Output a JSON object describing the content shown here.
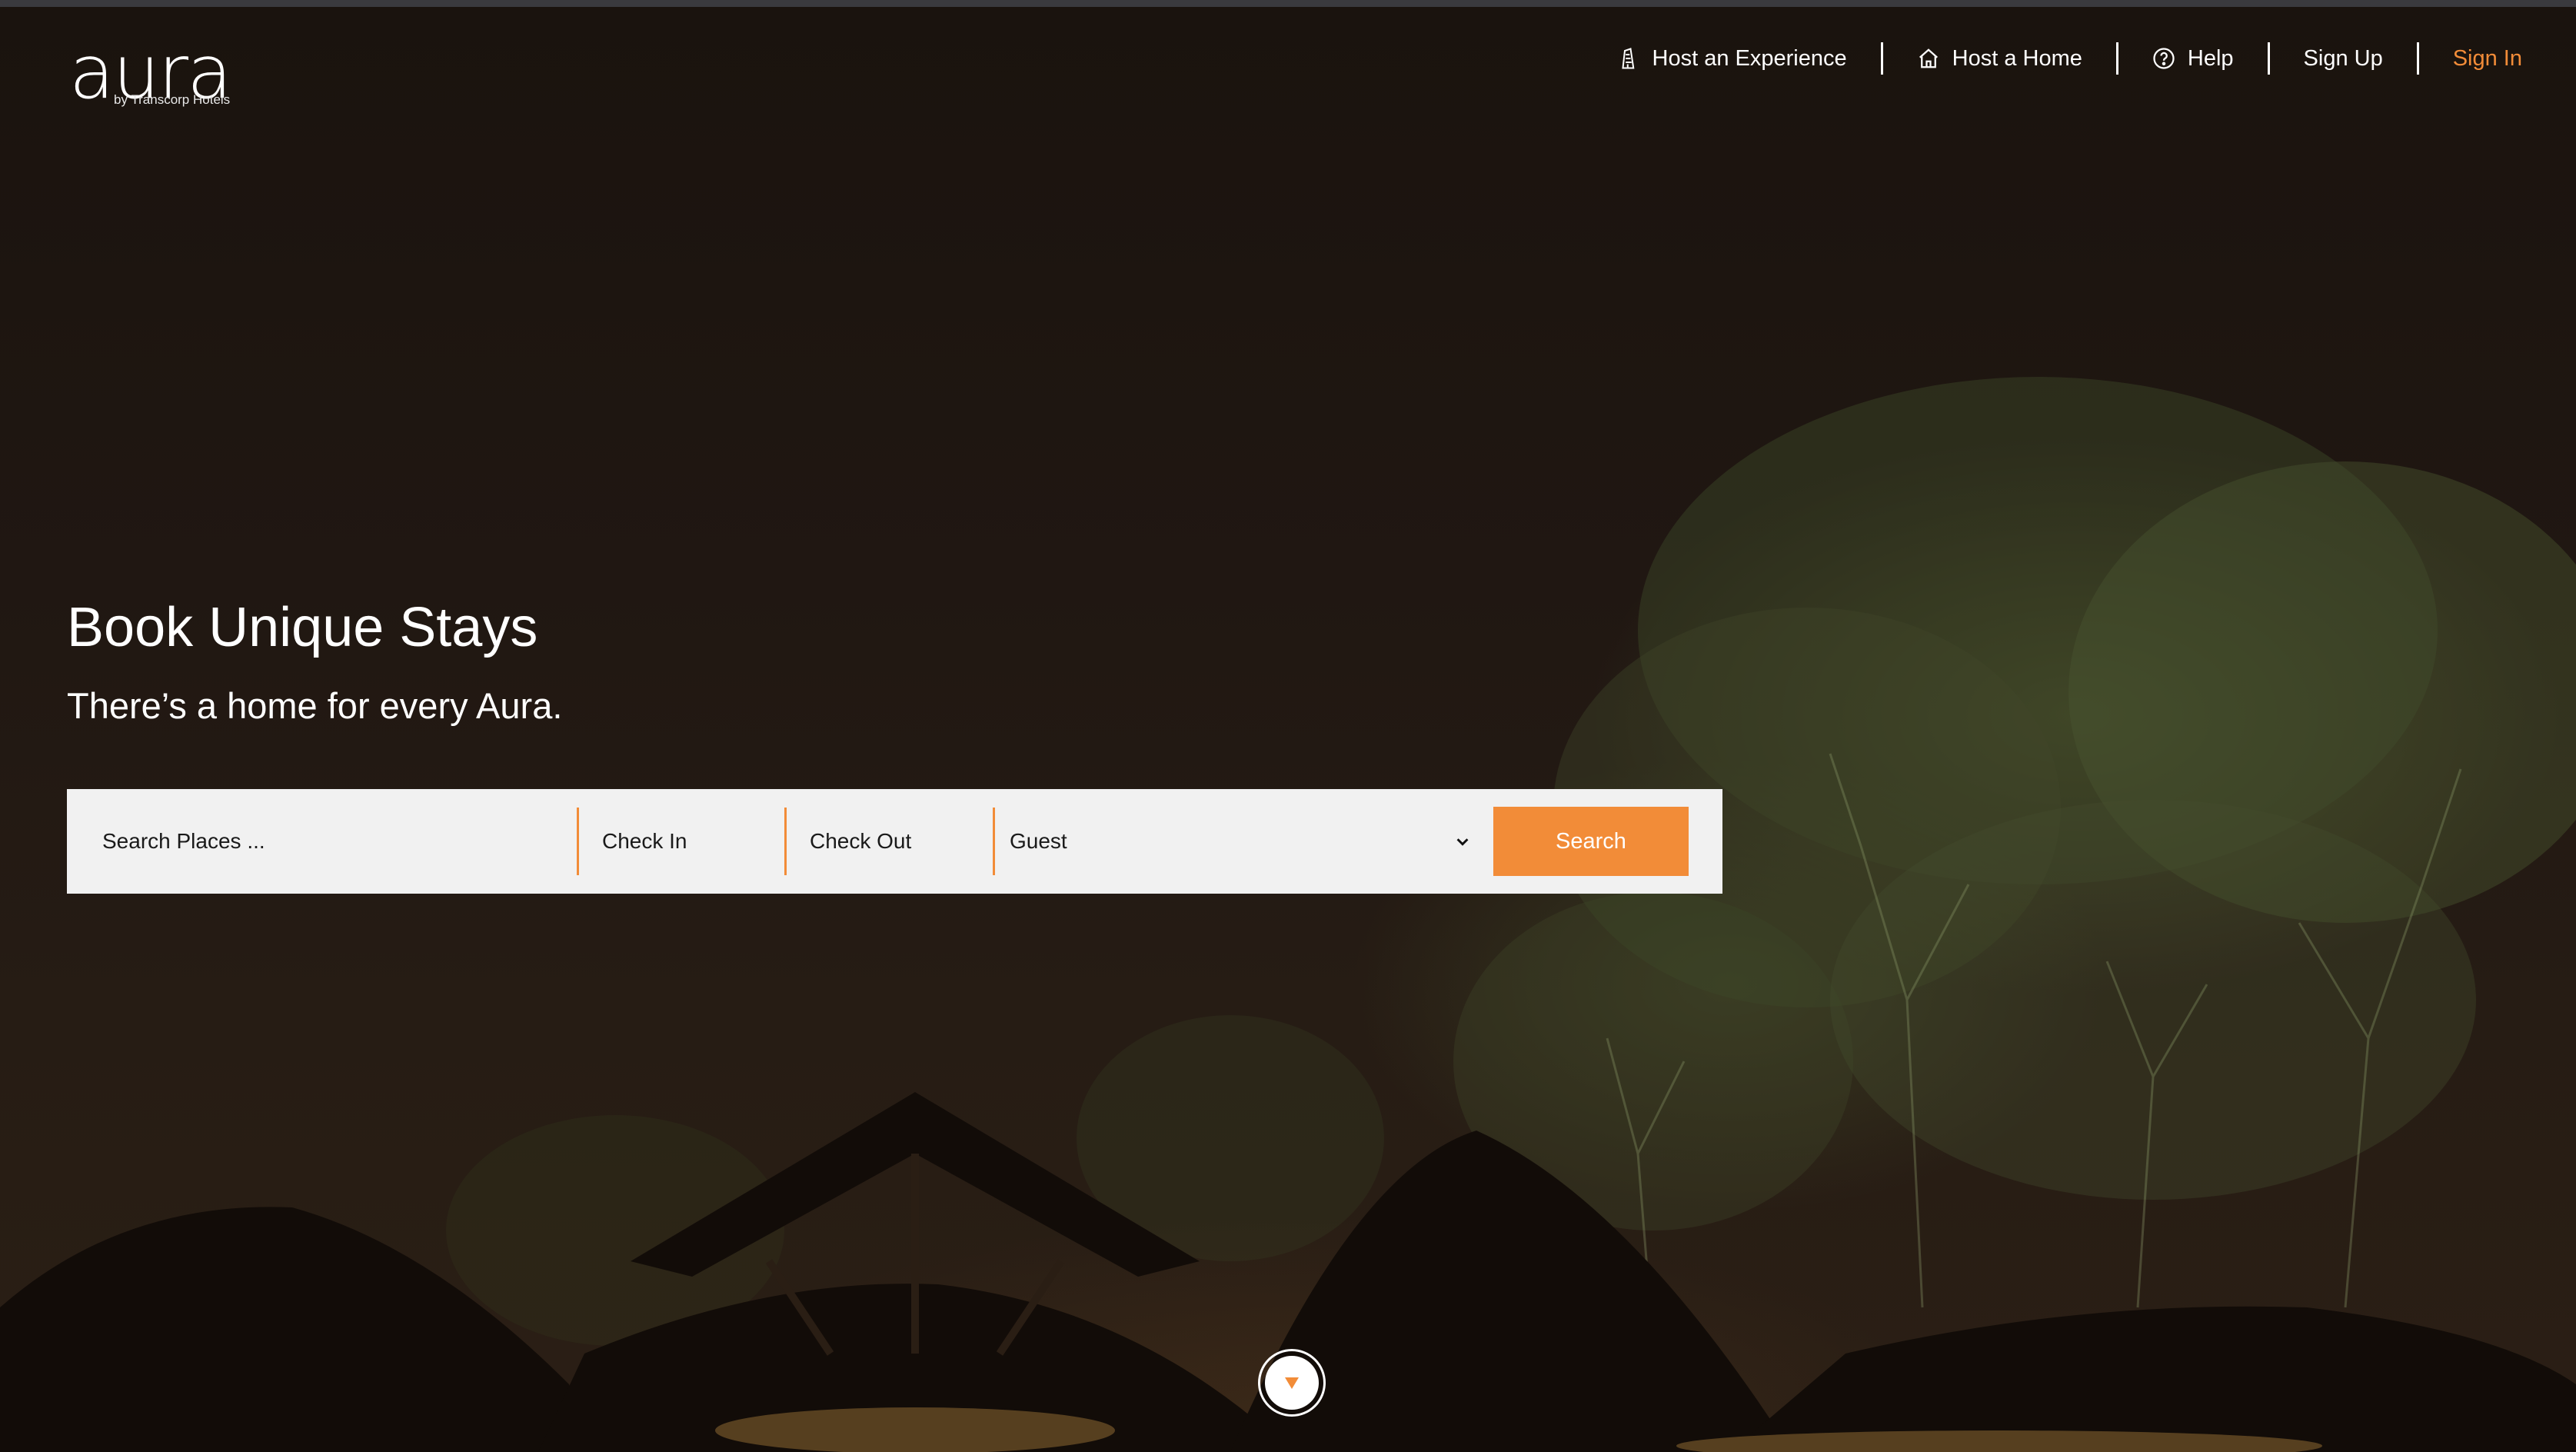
{
  "brand": {
    "logo_text": "aura",
    "logo_subtext": "by Transcorp Hotels"
  },
  "nav": {
    "host_experience": {
      "label": "Host an Experience",
      "icon": "building-icon"
    },
    "host_home": {
      "label": "Host a Home",
      "icon": "home-icon"
    },
    "help": {
      "label": "Help",
      "icon": "help-circle-icon"
    },
    "sign_up": {
      "label": "Sign Up"
    },
    "sign_in": {
      "label": "Sign In"
    }
  },
  "hero": {
    "title": "Book Unique Stays",
    "subtitle": "There’s a home for every Aura."
  },
  "search": {
    "places_placeholder": "Search Places ...",
    "check_in": "Check In",
    "check_out": "Check Out",
    "guest": "Guest",
    "button_label": "Search"
  },
  "scroll_button": {
    "icon": "caret-down-icon"
  },
  "colors": {
    "accent": "#f28c38",
    "text_light": "#ffffff",
    "search_bg": "#f1f1f1"
  }
}
